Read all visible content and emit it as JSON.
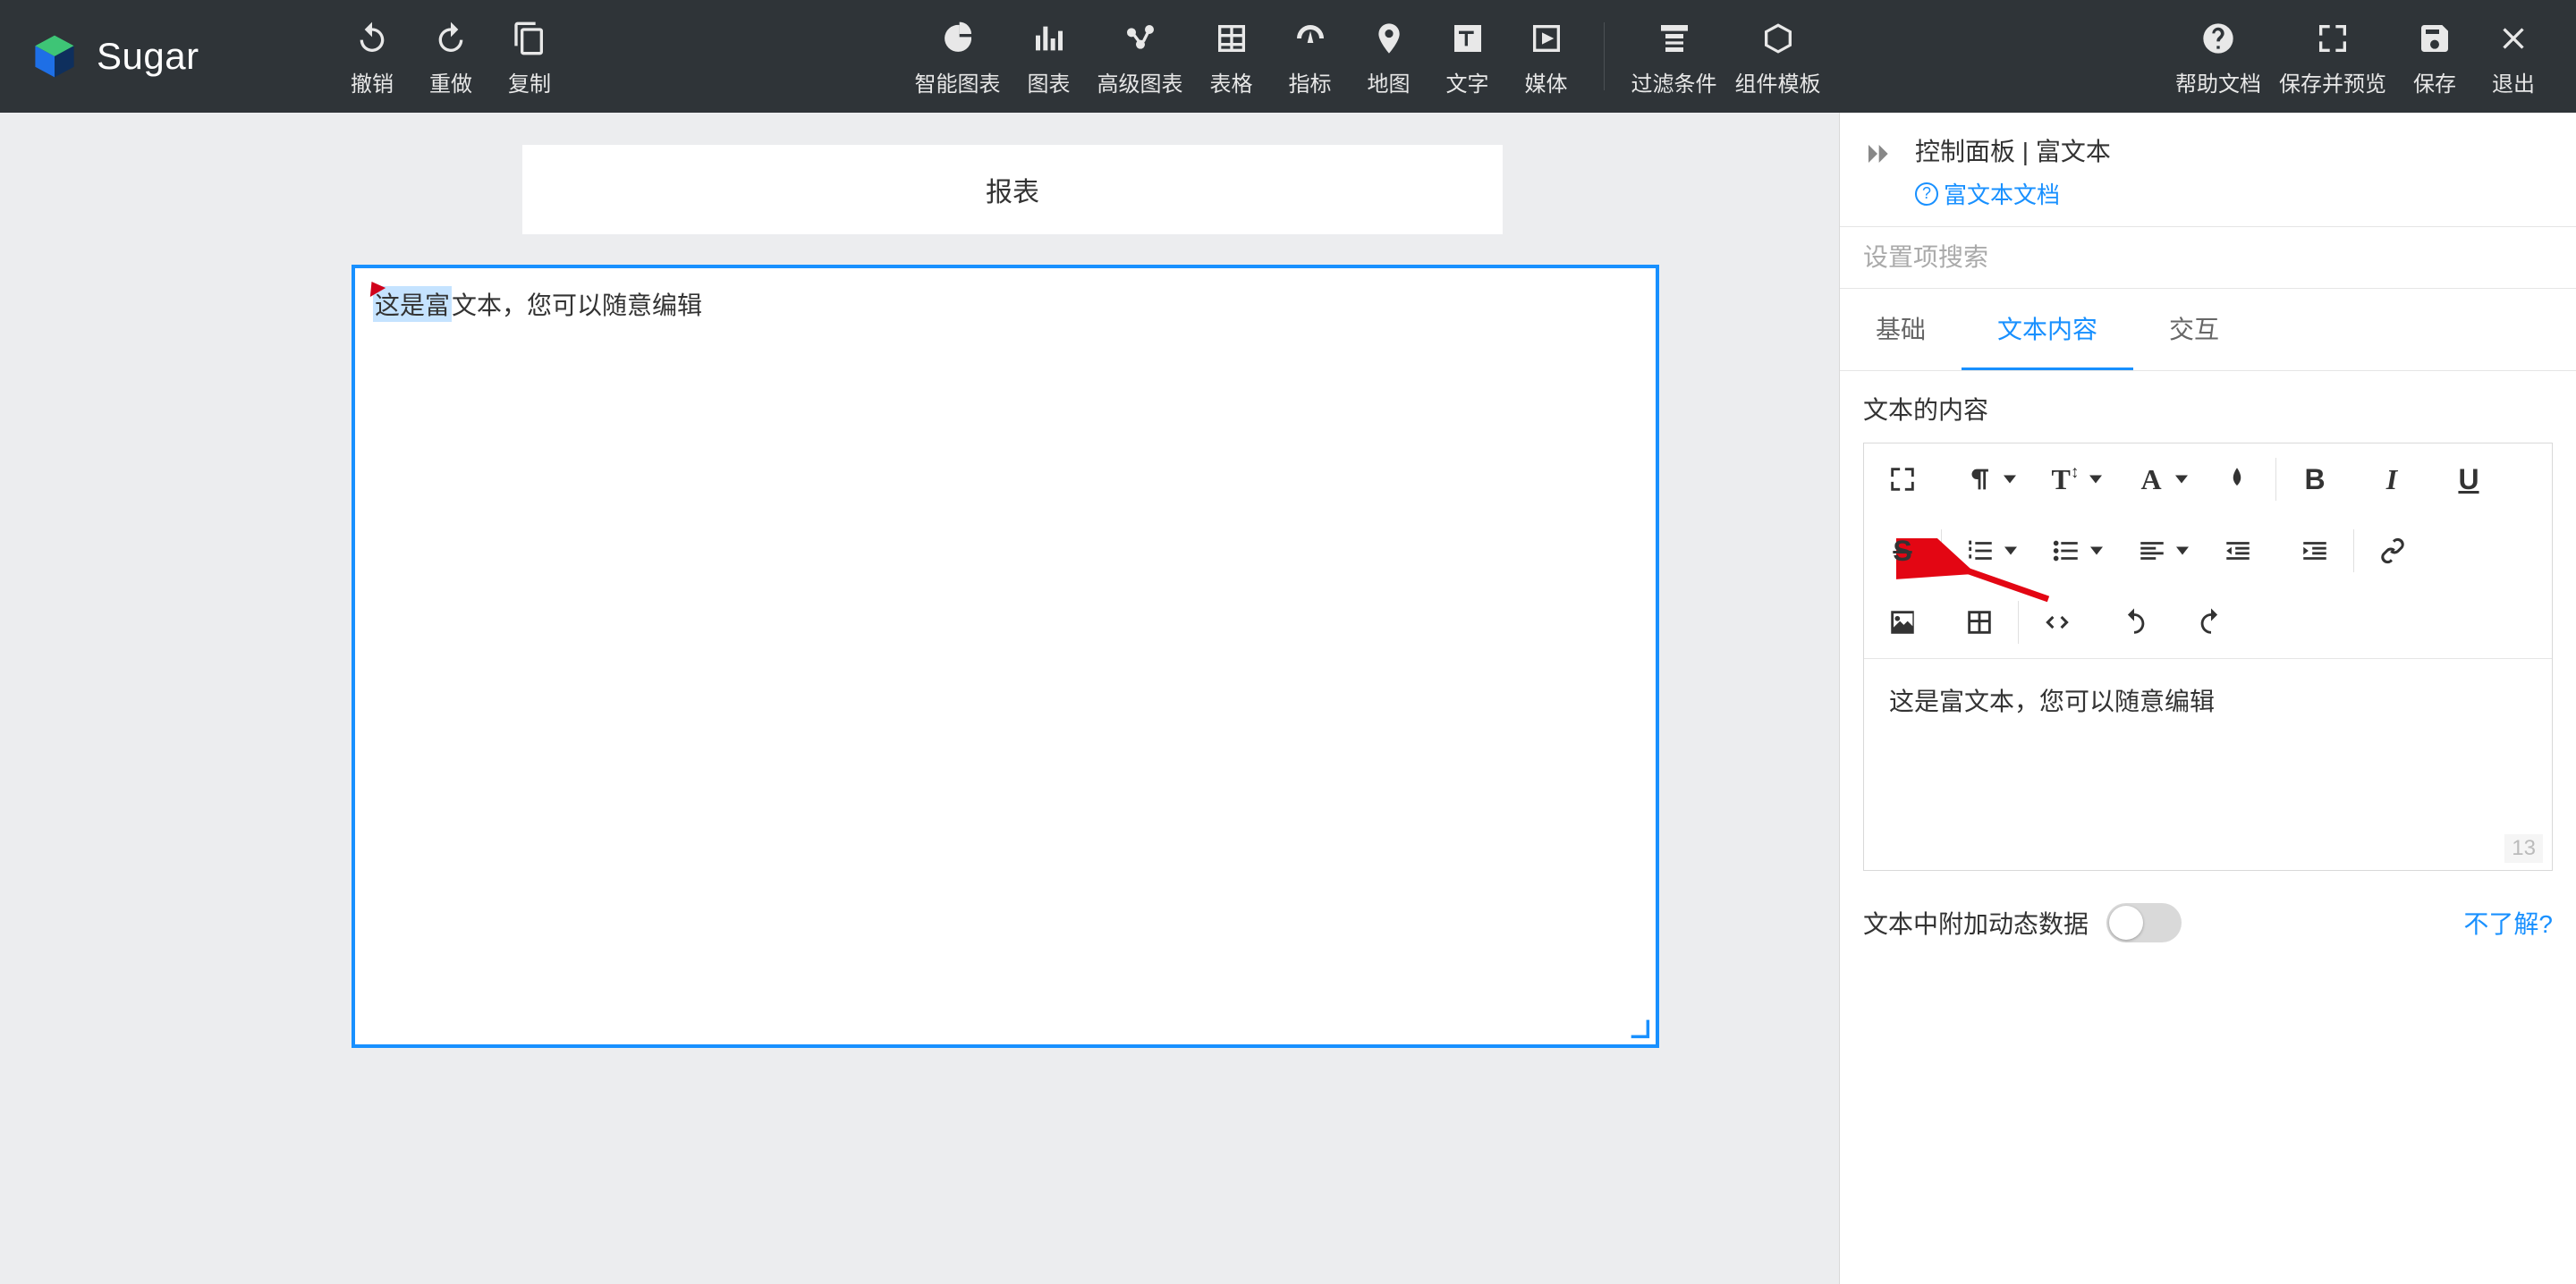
{
  "app": {
    "name": "Sugar"
  },
  "toolbar": {
    "left": [
      {
        "id": "undo",
        "label": "撤销"
      },
      {
        "id": "redo",
        "label": "重做"
      },
      {
        "id": "copy",
        "label": "复制"
      }
    ],
    "center_group1": [
      {
        "id": "smart-chart",
        "label": "智能图表"
      },
      {
        "id": "chart",
        "label": "图表"
      },
      {
        "id": "advanced-chart",
        "label": "高级图表"
      },
      {
        "id": "table",
        "label": "表格"
      },
      {
        "id": "indicator",
        "label": "指标"
      },
      {
        "id": "map",
        "label": "地图"
      },
      {
        "id": "text",
        "label": "文字"
      },
      {
        "id": "media",
        "label": "媒体"
      }
    ],
    "center_group2": [
      {
        "id": "filter",
        "label": "过滤条件"
      },
      {
        "id": "template",
        "label": "组件模板"
      }
    ],
    "right": [
      {
        "id": "help",
        "label": "帮助文档"
      },
      {
        "id": "save-preview",
        "label": "保存并预览"
      },
      {
        "id": "save",
        "label": "保存"
      },
      {
        "id": "exit",
        "label": "退出"
      }
    ]
  },
  "canvas": {
    "report_title": "报表",
    "richtext_selected_prefix": "这是富",
    "richtext_remaining": "文本，您可以随意编辑"
  },
  "panel": {
    "title": "控制面板 | 富文本",
    "doc_link": "富文本文档",
    "search_placeholder": "设置项搜索",
    "tabs": [
      {
        "id": "basic",
        "label": "基础"
      },
      {
        "id": "text-content",
        "label": "文本内容"
      },
      {
        "id": "interaction",
        "label": "交互"
      }
    ],
    "active_tab": "text-content",
    "section_label": "文本的内容",
    "editor_text": "这是富文本，您可以随意编辑",
    "char_count": "13",
    "dynamic_data_label": "文本中附加动态数据",
    "help_link": "不了解?"
  }
}
